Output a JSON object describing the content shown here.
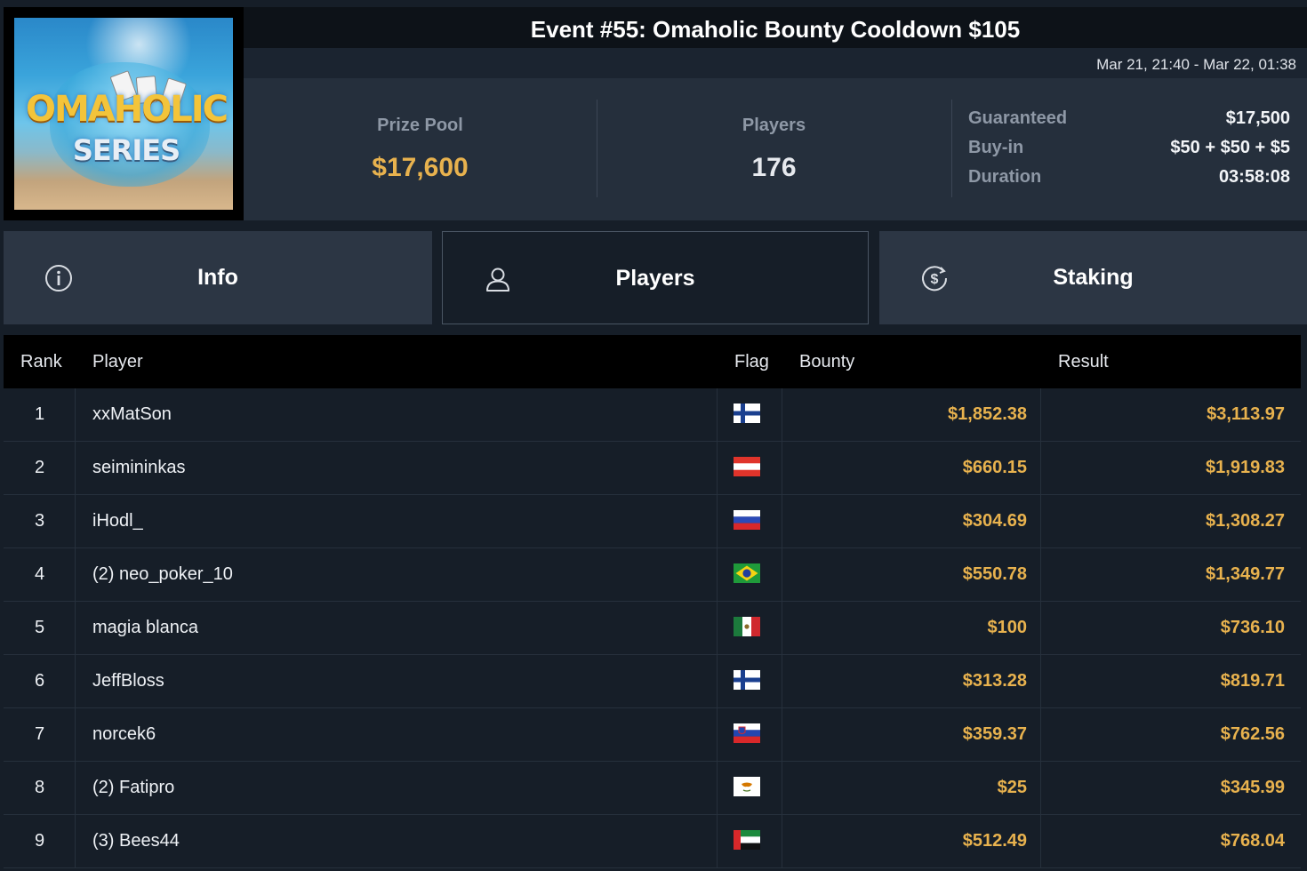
{
  "event": {
    "title": "Event #55: Omaholic Bounty Cooldown $105",
    "date_range": "Mar 21, 21:40 - Mar 22, 01:38",
    "logo_text_line1": "OMAHOLIC",
    "logo_text_line2": "SERIES"
  },
  "stats": {
    "prize_pool_label": "Prize Pool",
    "prize_pool_value": "$17,600",
    "players_label": "Players",
    "players_value": "176",
    "details": [
      {
        "label": "Guaranteed",
        "value": "$17,500"
      },
      {
        "label": "Buy-in",
        "value": "$50 + $50 + $5"
      },
      {
        "label": "Duration",
        "value": "03:58:08"
      }
    ]
  },
  "tabs": [
    {
      "label": "Info",
      "icon": "info-icon",
      "active": false
    },
    {
      "label": "Players",
      "icon": "user-icon",
      "active": true
    },
    {
      "label": "Staking",
      "icon": "dollar-coin-icon",
      "active": false
    }
  ],
  "table": {
    "headers": {
      "rank": "Rank",
      "player": "Player",
      "flag": "Flag",
      "bounty": "Bounty",
      "result": "Result"
    },
    "rows": [
      {
        "rank": "1",
        "player": "xxMatSon",
        "flag": "finland",
        "bounty": "$1,852.38",
        "result": "$3,113.97"
      },
      {
        "rank": "2",
        "player": "seimininkas",
        "flag": "austria",
        "bounty": "$660.15",
        "result": "$1,919.83"
      },
      {
        "rank": "3",
        "player": "iHodl_",
        "flag": "russia",
        "bounty": "$304.69",
        "result": "$1,308.27"
      },
      {
        "rank": "4",
        "player": "(2) neo_poker_10",
        "flag": "brazil",
        "bounty": "$550.78",
        "result": "$1,349.77"
      },
      {
        "rank": "5",
        "player": "magia blanca",
        "flag": "mexico",
        "bounty": "$100",
        "result": "$736.10"
      },
      {
        "rank": "6",
        "player": "JeffBloss",
        "flag": "finland",
        "bounty": "$313.28",
        "result": "$819.71"
      },
      {
        "rank": "7",
        "player": "norcek6",
        "flag": "slovenia",
        "bounty": "$359.37",
        "result": "$762.56"
      },
      {
        "rank": "8",
        "player": "(2) Fatipro",
        "flag": "cyprus",
        "bounty": "$25",
        "result": "$345.99"
      },
      {
        "rank": "9",
        "player": "(3) Bees44",
        "flag": "uae",
        "bounty": "$512.49",
        "result": "$768.04"
      }
    ]
  },
  "colors": {
    "accent_gold": "#e8b24e",
    "background": "#161e28",
    "panel": "#252f3c",
    "tab": "#2c3644"
  }
}
